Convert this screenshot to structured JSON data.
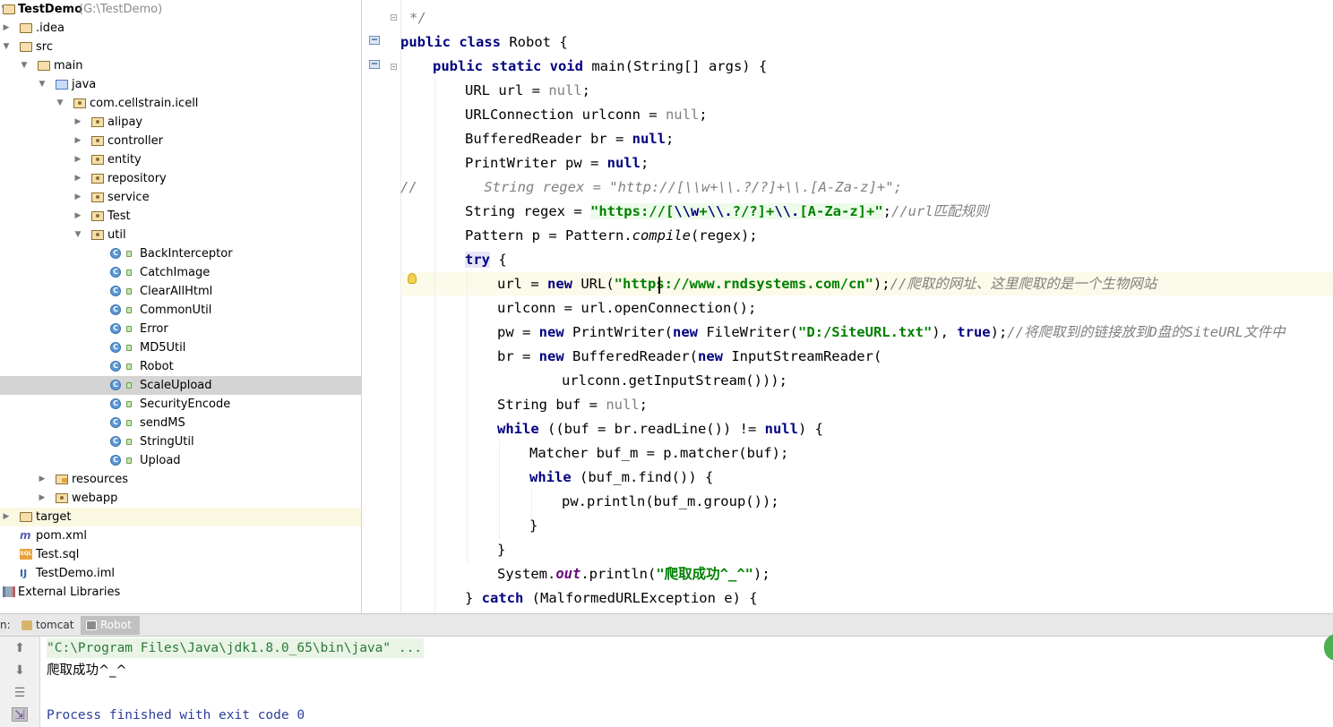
{
  "tree": {
    "root": {
      "label": "TestDemo",
      "path": "(G:\\TestDemo)"
    },
    "items": [
      {
        "label": ".idea"
      },
      {
        "label": "src"
      },
      {
        "label": "main"
      },
      {
        "label": "java"
      },
      {
        "label": "com.cellstrain.icell"
      },
      {
        "label": "alipay"
      },
      {
        "label": "controller"
      },
      {
        "label": "entity"
      },
      {
        "label": "repository"
      },
      {
        "label": "service"
      },
      {
        "label": "Test"
      },
      {
        "label": "util"
      },
      {
        "label": "BackInterceptor"
      },
      {
        "label": "CatchImage"
      },
      {
        "label": "ClearAllHtml"
      },
      {
        "label": "CommonUtil"
      },
      {
        "label": "Error"
      },
      {
        "label": "MD5Util"
      },
      {
        "label": "Robot"
      },
      {
        "label": "ScaleUpload"
      },
      {
        "label": "SecurityEncode"
      },
      {
        "label": "sendMS"
      },
      {
        "label": "StringUtil"
      },
      {
        "label": "Upload"
      },
      {
        "label": "resources"
      },
      {
        "label": "webapp"
      },
      {
        "label": "target"
      },
      {
        "label": "pom.xml"
      },
      {
        "label": "Test.sql"
      },
      {
        "label": "TestDemo.iml"
      },
      {
        "label": "External Libraries"
      }
    ]
  },
  "editor": {
    "code": {
      "l0": "*/",
      "l1a": "public class ",
      "l1b": "Robot {",
      "l2a": "public static void ",
      "l2b": "main(String[] args) {",
      "l3a": "URL url = ",
      "l3b": "null",
      "l3c": ";",
      "l4a": "URLConnection urlconn = ",
      "l4b": "null",
      "l4c": ";",
      "l5a": "BufferedReader br = ",
      "l5b": "null",
      "l5c": ";",
      "l6a": "PrintWriter pw = ",
      "l6b": "null",
      "l6c": ";",
      "l7": "//        String regex = \"http://[\\\\w+\\\\.?/?]+\\\\.[A-Za-z]+\";",
      "l8a": "String regex = ",
      "l8b": "\"https://[",
      "l8c": "\\\\w",
      "l8d": "+",
      "l8e": "\\\\.",
      "l8f": "?/?]+",
      "l8g": "\\\\.",
      "l8h": "[A-Za-z]+\"",
      "l8i": ";",
      "l8j": "//url匹配规则",
      "l9a": "Pattern p = Pattern.",
      "l9b": "compile",
      "l9c": "(regex);",
      "l10a": "try",
      "l10b": " {",
      "l11a": "url = ",
      "l11b": "new",
      "l11c": " URL(",
      "l11d": "\"https://www.rndsystems.com/cn\"",
      "l11e": ");",
      "l11f": "//爬取的网址、这里爬取的是一个生物网站",
      "l12": "urlconn = url.openConnection();",
      "l13a": "pw = ",
      "l13b": "new",
      "l13c": " PrintWriter(",
      "l13d": "new",
      "l13e": " FileWriter(",
      "l13f": "\"D:/SiteURL.txt\"",
      "l13g": "), ",
      "l13h": "true",
      "l13i": ");",
      "l13j": "//将爬取到的链接放到D盘的SiteURL文件中",
      "l14a": "br = ",
      "l14b": "new",
      "l14c": " BufferedReader(",
      "l14d": "new",
      "l14e": " InputStreamReader(",
      "l15": "urlconn.getInputStream()));",
      "l16a": "String buf = ",
      "l16b": "null",
      "l16c": ";",
      "l17a": "while",
      "l17b": " ((buf = br.readLine()) != ",
      "l17c": "null",
      "l17d": ") {",
      "l18": "Matcher buf_m = p.matcher(buf);",
      "l19a": "while",
      "l19b": " (buf_m.find()) {",
      "l20": "pw.println(buf_m.group());",
      "l21": "}",
      "l22": "}",
      "l23a": "System.",
      "l23b": "out",
      "l23c": ".println(",
      "l23d": "\"爬取成功^_^\"",
      "l23e": ");",
      "l24a": "} ",
      "l24b": "catch",
      "l24c": " (MalformedURLException e) {"
    }
  },
  "run": {
    "label": "n:",
    "tabs": [
      {
        "label": "tomcat"
      },
      {
        "label": "Robot"
      }
    ],
    "output": {
      "cmd": "\"C:\\Program Files\\Java\\jdk1.8.0_65\\bin\\java\" ...",
      "result": "爬取成功^_^",
      "finished": "Process finished with exit code 0"
    }
  },
  "colors": {
    "keyword": "#000080",
    "string": "#008000",
    "comment": "#808080",
    "selection": "#d4d4d4",
    "caret_line": "#fcfae8"
  }
}
